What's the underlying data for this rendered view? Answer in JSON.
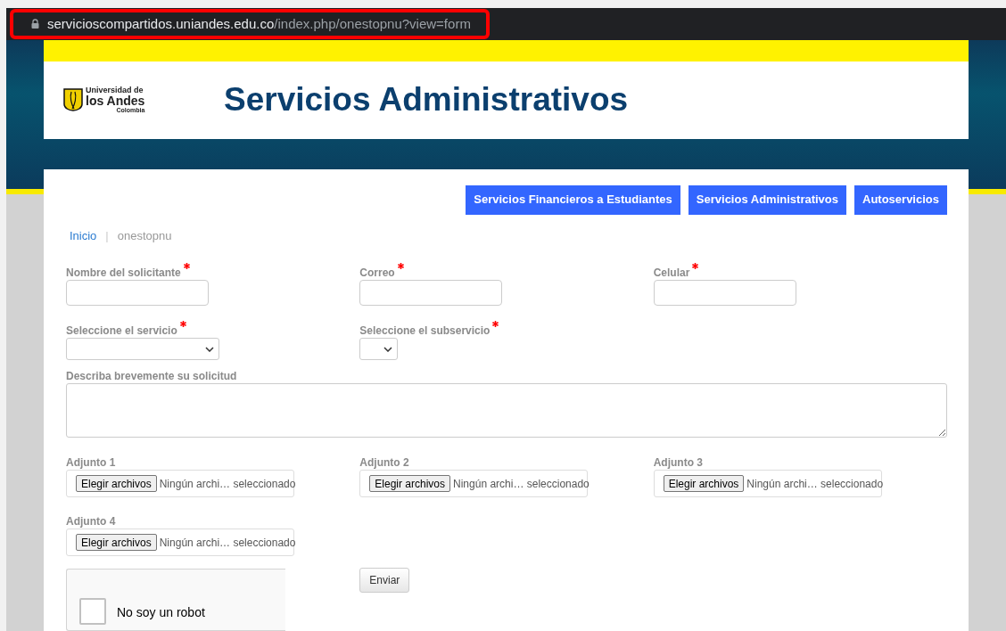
{
  "address_bar": {
    "host": "servicioscompartidos.uniandes.edu.co",
    "path": "/index.php/onestopnu?view=form",
    "highlighted": true
  },
  "header": {
    "logo": {
      "line_1": "Universidad de",
      "line_2": "los Andes",
      "line_3": "Colombia"
    },
    "title": "Servicios Administrativos"
  },
  "nav_buttons": [
    "Servicios Financieros a Estudiantes",
    "Servicios Administrativos",
    "Autoservicios"
  ],
  "breadcrumb": [
    {
      "label": "Inicio",
      "kind": "link"
    },
    {
      "label": "|",
      "kind": "separator"
    },
    {
      "label": "onestopnu",
      "kind": "current"
    }
  ],
  "fields_row_1": [
    {
      "label": "Nombre del solicitante",
      "required": true,
      "kind": "text"
    },
    {
      "label": "Correo",
      "required": true,
      "kind": "text"
    },
    {
      "label": "Celular",
      "required": true,
      "kind": "text"
    }
  ],
  "fields_row_2": [
    {
      "label": "Seleccione el servicio",
      "required": true,
      "kind": "select-wide"
    },
    {
      "label": "Seleccione el subservicio",
      "required": true,
      "kind": "select-narrow"
    }
  ],
  "description": {
    "label": "Describa brevemente su solicitud"
  },
  "attachments": [
    {
      "label": "Adjunto 1",
      "button": "Elegir archivos",
      "status": "Ningún archi… seleccionado"
    },
    {
      "label": "Adjunto 2",
      "button": "Elegir archivos",
      "status": "Ningún archi… seleccionado"
    },
    {
      "label": "Adjunto 3",
      "button": "Elegir archivos",
      "status": "Ningún archi… seleccionado"
    },
    {
      "label": "Adjunto 4",
      "button": "Elegir archivos",
      "status": "Ningún archi… seleccionado"
    }
  ],
  "captcha": {
    "label": "No soy un robot",
    "checked": false
  },
  "submit": "Enviar"
}
